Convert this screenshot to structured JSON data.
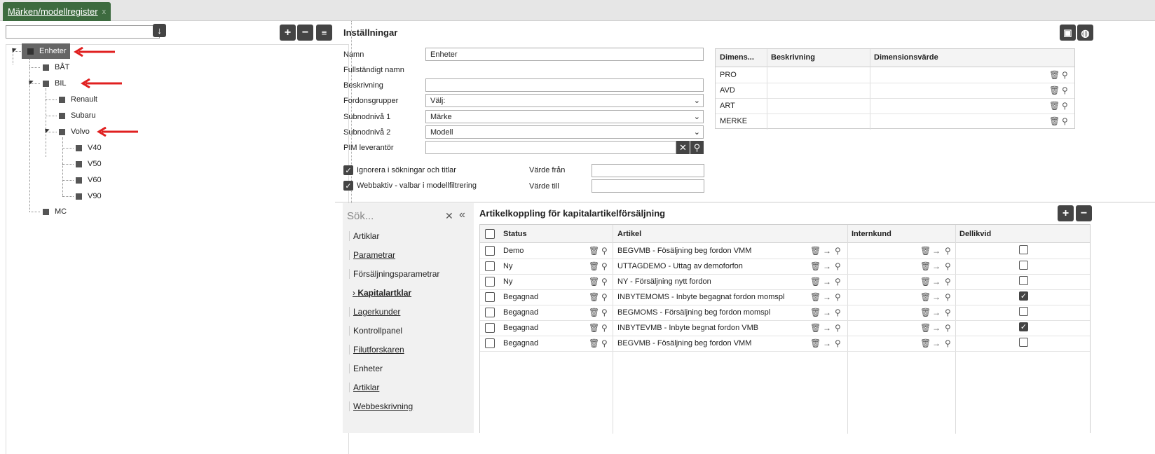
{
  "tab": {
    "label": "Märken/modellregister",
    "close": "x"
  },
  "tree": {
    "nodes": [
      "Enheter",
      "BÅT",
      "BIL",
      "Renault",
      "Subaru",
      "Volvo",
      "V40",
      "V50",
      "V60",
      "V90",
      "MC"
    ]
  },
  "settings": {
    "title": "Inställningar",
    "fields": {
      "namn_label": "Namn",
      "namn_value": "Enheter",
      "fullname_label": "Fullständigt namn",
      "beskrivning_label": "Beskrivning",
      "fordonsgrupper_label": "Fordonsgrupper",
      "fordonsgrupper_value": "Välj:",
      "sub1_label": "Subnodnivå 1",
      "sub1_value": "Märke",
      "sub2_label": "Subnodnivå 2",
      "sub2_value": "Modell",
      "pim_label": "PIM leverantör"
    },
    "checks": {
      "ignore": "Ignorera i sökningar och titlar",
      "webb": "Webbaktiv - valbar i modellfiltrering",
      "ignore_checked": true,
      "webb_checked": true
    },
    "varde": {
      "fran": "Värde från",
      "till": "Värde till"
    }
  },
  "dimensions": {
    "headers": [
      "Dimens...",
      "Beskrivning",
      "Dimensionsvärde"
    ],
    "rows": [
      "PRO",
      "AVD",
      "ART",
      "MERKE"
    ]
  },
  "menu": {
    "search_placeholder": "Sök...",
    "items": [
      "Artiklar",
      "Parametrar",
      "Försäljningsparametrar",
      "Kapitalartklar",
      "Lagerkunder",
      "Kontrollpanel",
      "Filutforskaren",
      "Enheter",
      "Artiklar",
      "Webbeskrivning"
    ]
  },
  "artikel": {
    "title": "Artikelkoppling för kapitalartikelförsäljning",
    "headers": [
      "Status",
      "Artikel",
      "Internkund",
      "Dellikvid"
    ],
    "rows": [
      {
        "status": "Demo",
        "artikel": "BEGVMB - Fösäljning beg fordon VMM",
        "dellikvid": false
      },
      {
        "status": "Ny",
        "artikel": "UTTAGDEMO - Uttag av demoforfon",
        "dellikvid": false
      },
      {
        "status": "Ny",
        "artikel": "NY - Försäljning nytt fordon",
        "dellikvid": false
      },
      {
        "status": "Begagnad",
        "artikel": "INBYTEMOMS - Inbyte begagnat fordon momspl",
        "dellikvid": true
      },
      {
        "status": "Begagnad",
        "artikel": "BEGMOMS - Försäljning beg fordon momspl",
        "dellikvid": false
      },
      {
        "status": "Begagnad",
        "artikel": "INBYTEVMB - Inbyte begnat fordon VMB",
        "dellikvid": true
      },
      {
        "status": "Begagnad",
        "artikel": "BEGVMB - Fösäljning beg fordon VMM",
        "dellikvid": false
      }
    ]
  },
  "colors": {
    "tab": "#3d6b3f",
    "button": "#444444",
    "arrow": "#e02020"
  }
}
